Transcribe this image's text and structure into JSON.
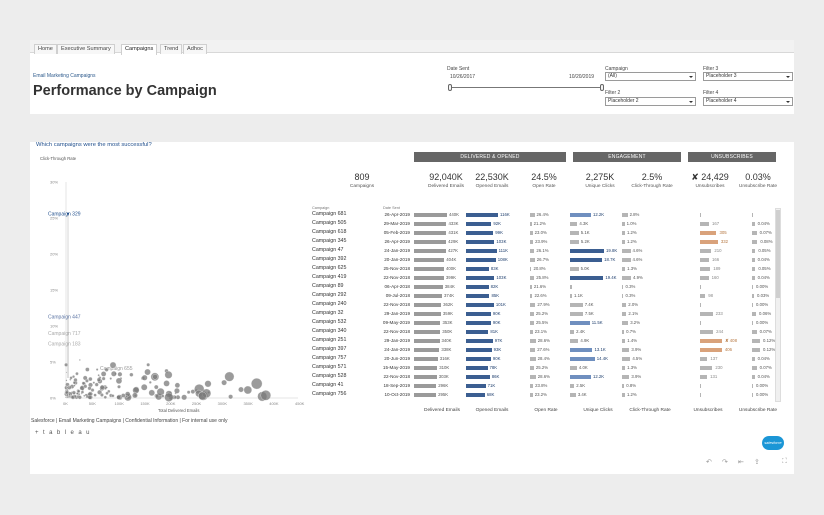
{
  "tabs": [
    {
      "label": "Home"
    },
    {
      "label": "Executive Summary"
    },
    {
      "label": "Campaigns",
      "active": true
    },
    {
      "label": "Trend"
    },
    {
      "label": "Adhoc"
    }
  ],
  "header": {
    "breadcrumb": "Email Marketing Campaigns",
    "title": "Performance by Campaign"
  },
  "filters": {
    "date_sent_label": "Date Sent",
    "date_start": "10/26/2017",
    "date_end": "10/20/2019",
    "campaign_label": "Campaign",
    "campaign_value": "(All)",
    "filter2_label": "Filter 2",
    "filter2_value": "Placeholder 2",
    "filter3_label": "Filter 3",
    "filter3_value": "Placeholder 3",
    "filter4_label": "Filter 4",
    "filter4_value": "Placeholder 4"
  },
  "question": "Which campaigns were the most successful?",
  "scatter": {
    "ylabel": "Click-Through Rate",
    "xlabel": "Total Delivered Emails",
    "yticks": [
      "30%",
      "25%",
      "20%",
      "15%",
      "10%",
      "5%",
      "0%"
    ],
    "xticks": [
      "0K",
      "50K",
      "100K",
      "150K",
      "200K",
      "250K",
      "300K",
      "350K",
      "400K",
      "450K"
    ],
    "labels": [
      "Campaign 329",
      "Campaign 447",
      "Campaign 717",
      "Campaign 183",
      "Campaign 655"
    ],
    "note": "One circle per Campaign, sized by Total Unique Clicks and colored by CTR (Click-Through Rate)"
  },
  "groups": [
    "DELIVERED & OPENED",
    "ENGAGEMENT",
    "UNSUBSCRIBES"
  ],
  "kpis": [
    {
      "value": "809",
      "label": "Campaigns"
    },
    {
      "value": "92,040K",
      "label": "Delivered Emails"
    },
    {
      "value": "22,530K",
      "label": "Opened Emails"
    },
    {
      "value": "24.5%",
      "label": "Open Rate"
    },
    {
      "value": "2,275K",
      "label": "Unique Clicks"
    },
    {
      "value": "2.5%",
      "label": "Click-Through Rate"
    },
    {
      "value": "✘ 24,429",
      "label": "Unsubscribes"
    },
    {
      "value": "0.03%",
      "label": "Unsubscribe Rate"
    }
  ],
  "col_headers": {
    "campaign": "Campaign",
    "date": "Date Sent"
  },
  "footer_labels": [
    "Delivered Emails",
    "Opened Emails",
    "Open Rate",
    "Unique Clicks",
    "Click-Through Rate",
    "Unsubscribes",
    "Unsubscribe Rate"
  ],
  "rows": [
    {
      "name": "Campaign 681",
      "date": "26-Apr-2019",
      "delivered": 440,
      "dl": "440K",
      "opened": 116,
      "ol": "116K",
      "or": 26.4,
      "orl": "26.4%",
      "clicks": 12.2,
      "cl": "12.2K",
      "ctr": 2.8,
      "ctrl": "2.8%",
      "unsub": 1,
      "ul": "",
      "ur": 0,
      "url": ""
    },
    {
      "name": "Campaign 505",
      "date": "29-Mar-2019",
      "delivered": 433,
      "dl": "433K",
      "opened": 92,
      "ol": "92K",
      "or": 21.2,
      "orl": "21.2%",
      "clicks": 4.3,
      "cl": "4.3K",
      "ctr": 1.0,
      "ctrl": "1.0%",
      "unsub": 167,
      "ul": "167",
      "ur": 0.04,
      "url": "0.04%"
    },
    {
      "name": "Campaign 618",
      "date": "05-Feb-2019",
      "delivered": 431,
      "dl": "431K",
      "opened": 99,
      "ol": "99K",
      "or": 23.0,
      "orl": "23.0%",
      "clicks": 5.1,
      "cl": "5.1K",
      "ctr": 1.2,
      "ctrl": "1.2%",
      "unsub": 305,
      "ul": "305",
      "ur": 0.07,
      "url": "0.07%"
    },
    {
      "name": "Campaign 345",
      "date": "26-Apr-2019",
      "delivered": 429,
      "dl": "429K",
      "opened": 103,
      "ol": "103K",
      "or": 23.9,
      "orl": "23.9%",
      "clicks": 5.2,
      "cl": "5.2K",
      "ctr": 1.2,
      "ctrl": "1.2%",
      "unsub": 332,
      "ul": "332",
      "ur": 0.08,
      "url": "0.08%"
    },
    {
      "name": "Campaign 47",
      "date": "24-Jan-2019",
      "delivered": 427,
      "dl": "427K",
      "opened": 111,
      "ol": "111K",
      "or": 26.1,
      "orl": "26.1%",
      "clicks": 19.8,
      "cl": "19.8K",
      "ctr": 4.6,
      "ctrl": "4.6%",
      "unsub": 210,
      "ul": "210",
      "ur": 0.05,
      "url": "0.05%"
    },
    {
      "name": "Campaign 392",
      "date": "20-Jan-2019",
      "delivered": 404,
      "dl": "404K",
      "opened": 108,
      "ol": "108K",
      "or": 26.7,
      "orl": "26.7%",
      "clicks": 18.7,
      "cl": "18.7K",
      "ctr": 4.6,
      "ctrl": "4.6%",
      "unsub": 166,
      "ul": "166",
      "ur": 0.04,
      "url": "0.04%"
    },
    {
      "name": "Campaign 625",
      "date": "25-Nov-2018",
      "delivered": 400,
      "dl": "400K",
      "opened": 83,
      "ol": "83K",
      "or": 20.8,
      "orl": "20.8%",
      "clicks": 5.0,
      "cl": "5.0K",
      "ctr": 1.3,
      "ctrl": "1.3%",
      "unsub": 189,
      "ul": "189",
      "ur": 0.05,
      "url": "0.05%"
    },
    {
      "name": "Campaign 419",
      "date": "22-Nov-2018",
      "delivered": 399,
      "dl": "399K",
      "opened": 103,
      "ol": "103K",
      "or": 25.8,
      "orl": "25.8%",
      "clicks": 19.4,
      "cl": "19.4K",
      "ctr": 4.9,
      "ctrl": "4.9%",
      "unsub": 160,
      "ul": "160",
      "ur": 0.04,
      "url": "0.04%"
    },
    {
      "name": "Campaign 89",
      "date": "06-Apr-2018",
      "delivered": 384,
      "dl": "384K",
      "opened": 82,
      "ol": "82K",
      "or": 21.6,
      "orl": "21.6%",
      "clicks": 1.0,
      "cl": "",
      "ctr": 0.3,
      "ctrl": "0.3%",
      "unsub": 1,
      "ul": "",
      "ur": 0,
      "url": "0.00%"
    },
    {
      "name": "Campaign 292",
      "date": "09-Jul-2018",
      "delivered": 374,
      "dl": "374K",
      "opened": 85,
      "ol": "85K",
      "or": 22.6,
      "orl": "22.6%",
      "clicks": 1.1,
      "cl": "1.1K",
      "ctr": 0.3,
      "ctrl": "0.3%",
      "unsub": 98,
      "ul": "98",
      "ur": 0.03,
      "url": "0.03%"
    },
    {
      "name": "Campaign 240",
      "date": "22-Nov-2018",
      "delivered": 362,
      "dl": "362K",
      "opened": 101,
      "ol": "101K",
      "or": 27.9,
      "orl": "27.9%",
      "clicks": 7.4,
      "cl": "7.4K",
      "ctr": 2.0,
      "ctrl": "2.0%",
      "unsub": 1,
      "ul": "",
      "ur": 0,
      "url": "0.00%"
    },
    {
      "name": "Campaign 32",
      "date": "29-Jan-2019",
      "delivered": 359,
      "dl": "359K",
      "opened": 90,
      "ol": "90K",
      "or": 25.2,
      "orl": "25.2%",
      "clicks": 7.5,
      "cl": "7.5K",
      "ctr": 2.1,
      "ctrl": "2.1%",
      "unsub": 233,
      "ul": "233",
      "ur": 0.06,
      "url": "0.06%"
    },
    {
      "name": "Campaign 532",
      "date": "09-May-2019",
      "delivered": 353,
      "dl": "353K",
      "opened": 90,
      "ol": "90K",
      "or": 25.5,
      "orl": "25.5%",
      "clicks": 11.5,
      "cl": "11.5K",
      "ctr": 3.2,
      "ctrl": "3.2%",
      "unsub": 1,
      "ul": "",
      "ur": 0,
      "url": "0.00%"
    },
    {
      "name": "Campaign 340",
      "date": "22-Nov-2018",
      "delivered": 350,
      "dl": "350K",
      "opened": 81,
      "ol": "81K",
      "or": 23.1,
      "orl": "23.1%",
      "clicks": 2.4,
      "cl": "2.4K",
      "ctr": 0.7,
      "ctrl": "0.7%",
      "unsub": 244,
      "ul": "244",
      "ur": 0.07,
      "url": "0.07%"
    },
    {
      "name": "Campaign 251",
      "date": "29-Jan-2019",
      "delivered": 340,
      "dl": "340K",
      "opened": 97,
      "ol": "97K",
      "or": 28.6,
      "orl": "28.6%",
      "clicks": 4.9,
      "cl": "4.9K",
      "ctr": 1.4,
      "ctrl": "1.4%",
      "unsub": 408,
      "ul": "✘ 408",
      "ur": 0.12,
      "url": "0.12%"
    },
    {
      "name": "Campaign 397",
      "date": "24-Jan-2019",
      "delivered": 338,
      "dl": "338K",
      "opened": 93,
      "ol": "93K",
      "or": 27.6,
      "orl": "27.6%",
      "clicks": 13.1,
      "cl": "13.1K",
      "ctr": 3.9,
      "ctrl": "3.9%",
      "unsub": 406,
      "ul": "406",
      "ur": 0.12,
      "url": "0.12%"
    },
    {
      "name": "Campaign 757",
      "date": "20-Jun-2019",
      "delivered": 316,
      "dl": "316K",
      "opened": 90,
      "ol": "90K",
      "or": 28.4,
      "orl": "28.4%",
      "clicks": 14.4,
      "cl": "14.4K",
      "ctr": 4.5,
      "ctrl": "4.5%",
      "unsub": 137,
      "ul": "137",
      "ur": 0.04,
      "url": "0.04%"
    },
    {
      "name": "Campaign 571",
      "date": "15-May-2019",
      "delivered": 310,
      "dl": "310K",
      "opened": 78,
      "ol": "78K",
      "or": 25.2,
      "orl": "25.2%",
      "clicks": 4.0,
      "cl": "4.0K",
      "ctr": 1.3,
      "ctrl": "1.3%",
      "unsub": 230,
      "ul": "230",
      "ur": 0.07,
      "url": "0.07%"
    },
    {
      "name": "Campaign 528",
      "date": "22-Nov-2018",
      "delivered": 303,
      "dl": "303K",
      "opened": 86,
      "ol": "86K",
      "or": 28.6,
      "orl": "28.6%",
      "clicks": 12.2,
      "cl": "12.2K",
      "ctr": 3.9,
      "ctrl": "3.9%",
      "unsub": 131,
      "ul": "131",
      "ur": 0.04,
      "url": "0.04%"
    },
    {
      "name": "Campaign 41",
      "date": "18-Sep-2019",
      "delivered": 296,
      "dl": "296K",
      "opened": 71,
      "ol": "71K",
      "or": 23.8,
      "orl": "23.8%",
      "clicks": 2.5,
      "cl": "2.5K",
      "ctr": 0.8,
      "ctrl": "0.8%",
      "unsub": 1,
      "ul": "",
      "ur": 0,
      "url": "0.00%"
    },
    {
      "name": "Campaign 756",
      "date": "10-Oct-2019",
      "delivered": 295,
      "dl": "295K",
      "opened": 68,
      "ol": "68K",
      "or": 23.2,
      "orl": "23.2%",
      "clicks": 3.4,
      "cl": "3.4K",
      "ctr": 1.2,
      "ctrl": "1.2%",
      "unsub": 1,
      "ul": "",
      "ur": 0,
      "url": "0.00%"
    }
  ],
  "footer": {
    "text": "Salesforce | Email Marketing Campaigns | Confidential Information | For internal use only",
    "brand": "+ t a b l e a u",
    "sf": "salesforce"
  },
  "colors": {
    "bar_grey": "#9a9a9a",
    "bar_blue": "#3b5e91",
    "bar_lightblue": "#6f8fbf",
    "bar_orange": "#d9a27b",
    "header_grey": "#666666"
  }
}
